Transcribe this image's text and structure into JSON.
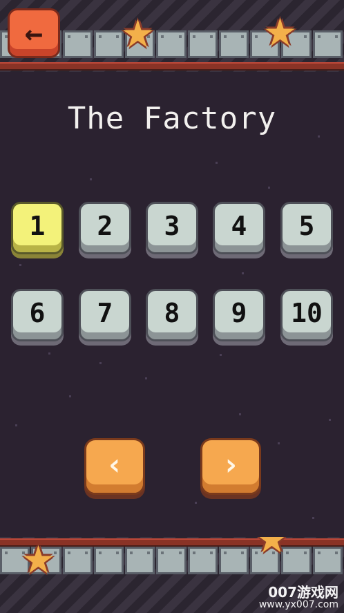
{
  "header": {
    "back_icon": "arrow-left-icon",
    "back_glyph": "←"
  },
  "title": "The Factory",
  "levels": [
    {
      "label": "1",
      "state": "current"
    },
    {
      "label": "2",
      "state": "normal"
    },
    {
      "label": "3",
      "state": "normal"
    },
    {
      "label": "4",
      "state": "normal"
    },
    {
      "label": "5",
      "state": "normal"
    },
    {
      "label": "6",
      "state": "normal"
    },
    {
      "label": "7",
      "state": "normal"
    },
    {
      "label": "8",
      "state": "normal"
    },
    {
      "label": "9",
      "state": "normal"
    },
    {
      "label": "10",
      "state": "normal"
    }
  ],
  "pager": {
    "prev_glyph": "‹",
    "next_glyph": "›",
    "prev_icon": "chevron-left-icon",
    "next_icon": "chevron-right-icon"
  },
  "watermark": {
    "line1": "007游戏网",
    "line2": "www.yx007.com"
  },
  "colors": {
    "background": "#2b2230",
    "level_button": "#c9d6d0",
    "level_current": "#f3f27a",
    "arrow_button": "#f6a84f",
    "back_button": "#f06a3f",
    "star": "#f3b04a"
  }
}
